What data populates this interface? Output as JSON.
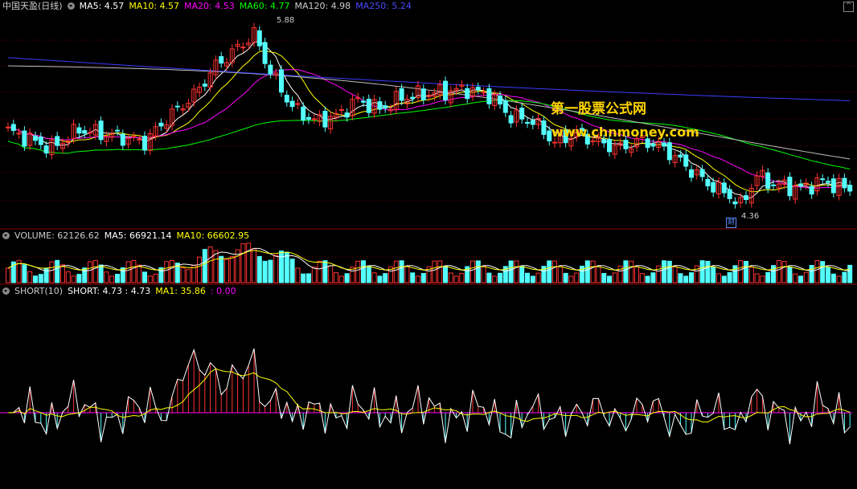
{
  "header": {
    "stock": "中国天盈(日线)",
    "ma5": "MA5: 4.57",
    "ma10": "MA10: 4.57",
    "ma20": "MA20: 4.53",
    "ma60": "MA60: 4.77",
    "ma120": "MA120: 4.98",
    "ma250": "MA250: 5.24"
  },
  "volume_header": {
    "volume": "VOLUME: 62126.62",
    "ma5": "MA5: 66921.14",
    "ma10": "MA10: 66602.95"
  },
  "short_header": {
    "name": "SHORT(10)",
    "short": "SHORT: 4.73 : 4.73",
    "ma1": "MA1: 35.86",
    "extra": ": 0.00"
  },
  "watermark": {
    "line1": "第一股票公式网",
    "line2": "www.chnmoney.com"
  },
  "annotations": {
    "high": "5.88",
    "low": "4.36",
    "marker": "财"
  },
  "colors": {
    "up": "#ff3232",
    "down": "#54ffff",
    "ma5": "#ffffff",
    "ma10": "#ffff00",
    "ma20": "#ff00ff",
    "ma60": "#00ff00",
    "ma120": "#c0c0c0",
    "ma250": "#3c3cff",
    "grid": "#6a0000"
  },
  "chart_data": [
    {
      "type": "candlestick",
      "ylim": [
        4.2,
        6.0
      ],
      "series_names": [
        "MA5",
        "MA10",
        "MA20",
        "MA60",
        "MA120",
        "MA250"
      ],
      "close_anchors": [
        [
          0,
          5.0
        ],
        [
          8,
          4.85
        ],
        [
          13,
          5.01
        ],
        [
          20,
          4.95
        ],
        [
          25,
          4.9
        ],
        [
          29,
          5.1
        ],
        [
          34,
          5.3
        ],
        [
          38,
          5.55
        ],
        [
          42,
          5.7
        ],
        [
          45,
          5.82
        ],
        [
          48,
          5.5
        ],
        [
          52,
          5.2
        ],
        [
          56,
          5.08
        ],
        [
          60,
          5.12
        ],
        [
          64,
          5.26
        ],
        [
          68,
          5.18
        ],
        [
          72,
          5.28
        ],
        [
          76,
          5.31
        ],
        [
          80,
          5.33
        ],
        [
          84,
          5.35
        ],
        [
          88,
          5.3
        ],
        [
          92,
          5.12
        ],
        [
          96,
          5.08
        ],
        [
          100,
          4.9
        ],
        [
          104,
          4.98
        ],
        [
          108,
          4.9
        ],
        [
          112,
          4.85
        ],
        [
          116,
          4.92
        ],
        [
          120,
          4.85
        ],
        [
          124,
          4.7
        ],
        [
          128,
          4.55
        ],
        [
          132,
          4.45
        ],
        [
          134,
          4.36
        ],
        [
          137,
          4.62
        ],
        [
          140,
          4.54
        ],
        [
          145,
          4.51
        ],
        [
          149,
          4.57
        ],
        [
          154,
          4.5
        ]
      ],
      "low_point": 4.36,
      "high_point": 5.88
    },
    {
      "type": "bar",
      "name": "VOLUME",
      "value": 62126.62,
      "ma5": 66921.14,
      "ma10": 66602.95
    },
    {
      "type": "bar",
      "name": "SHORT(10)",
      "short": 4.73,
      "ma1": 35.86
    }
  ]
}
